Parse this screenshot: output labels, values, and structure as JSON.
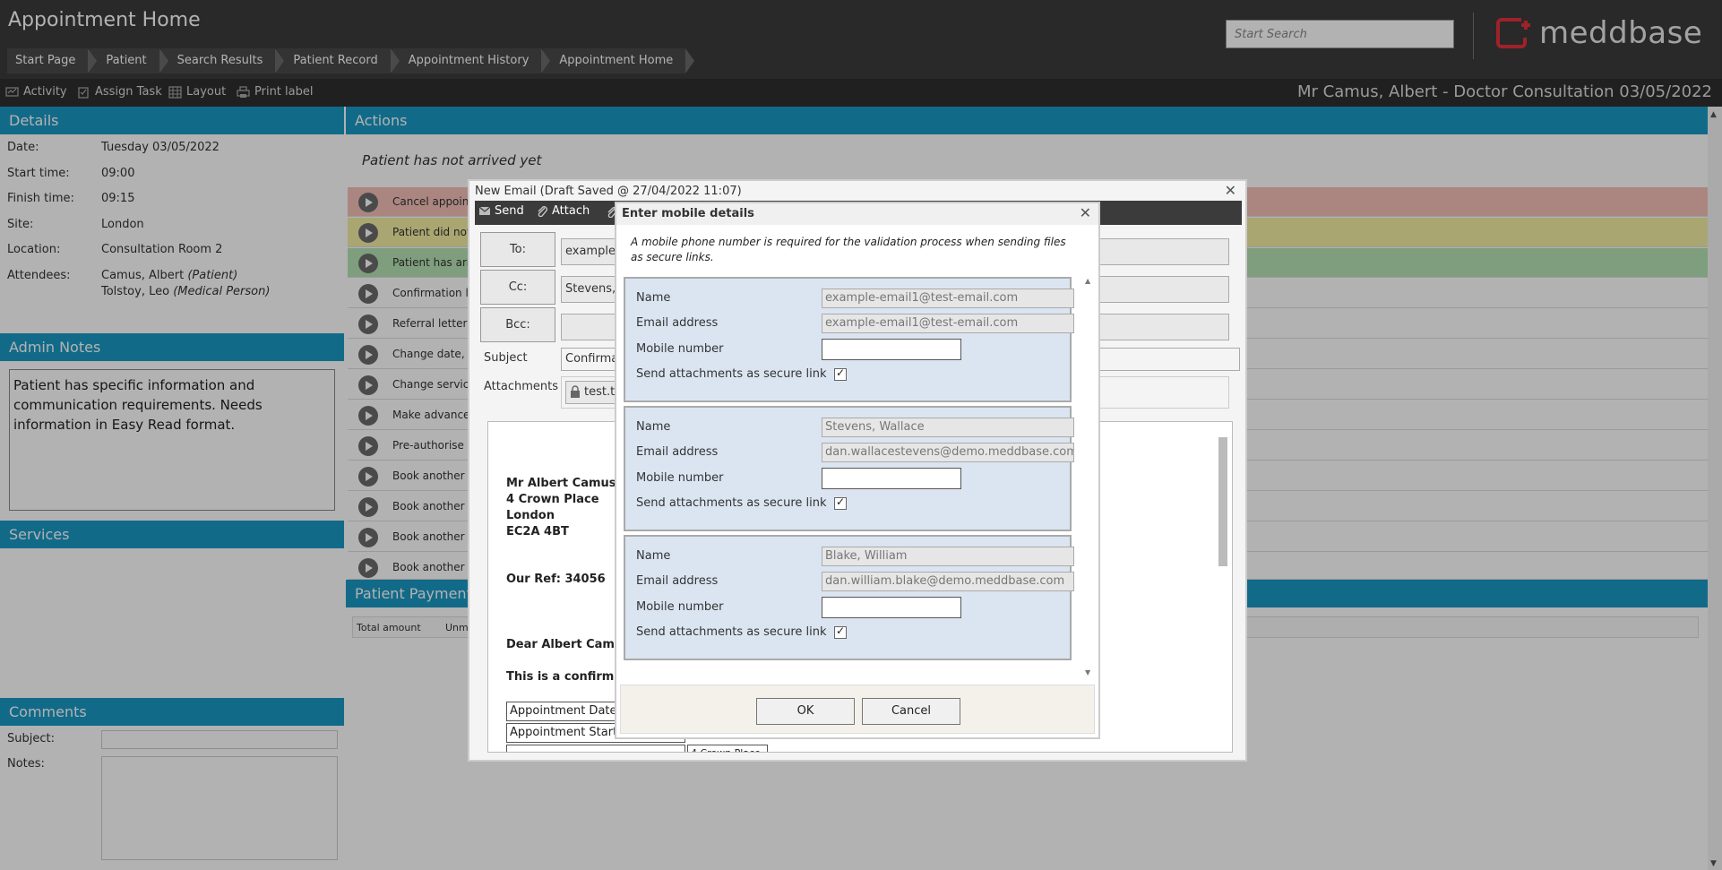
{
  "app": {
    "title": "Appointment Home",
    "search_placeholder": "Start Search",
    "logo_text": "meddbase",
    "brand_color": "#e2323b",
    "accent_color": "#1a98c5"
  },
  "breadcrumb": [
    "Start Page",
    "Patient",
    "Search Results",
    "Patient Record",
    "Appointment History",
    "Appointment Home"
  ],
  "toolbar": {
    "items": [
      {
        "label": "Activity",
        "icon": "activity-icon"
      },
      {
        "label": "Assign Task",
        "icon": "clipboard-icon"
      },
      {
        "label": "Layout",
        "icon": "grid-icon"
      },
      {
        "label": "Print label",
        "icon": "printer-icon"
      }
    ],
    "appointment_title": "Mr Camus, Albert - Doctor Consultation 03/05/2022"
  },
  "details": {
    "heading": "Details",
    "date_label": "Date:",
    "date": "Tuesday 03/05/2022",
    "start_label": "Start time:",
    "start": "09:00",
    "finish_label": "Finish time:",
    "finish": "09:15",
    "site_label": "Site:",
    "site": "London",
    "location_label": "Location:",
    "location": "Consultation Room 2",
    "attendees_label": "Attendees:",
    "attendee1_name": "Camus, Albert",
    "attendee1_role": "(Patient)",
    "attendee2_name": "Tolstoy, Leo",
    "attendee2_role": "(Medical Person)"
  },
  "admin_notes": {
    "heading": "Admin Notes",
    "text": "Patient has specific information and communication requirements. Needs information in Easy Read format."
  },
  "services": {
    "heading": "Services"
  },
  "comments": {
    "heading": "Comments",
    "subject_label": "Subject:",
    "notes_label": "Notes:"
  },
  "actions": {
    "heading": "Actions",
    "status": "Patient has not arrived yet",
    "rows": [
      "Cancel appoint",
      "Patient did not",
      "Patient has arri",
      "Confirmation le",
      "Referral letter a",
      "Change date, ti",
      "Change service",
      "Make advance p",
      "Pre-authorise p",
      "Book another a",
      "Book another a",
      "Book another a",
      "Book another a"
    ]
  },
  "payments": {
    "heading": "Patient Payments",
    "total_label": "Total amount",
    "col2": "Unm"
  },
  "email": {
    "title": "New Email (Draft Saved @ 27/04/2022 11:07)",
    "send": "Send",
    "attach": "Attach",
    "to_label": "To:",
    "to_value": "example-e",
    "cc_label": "Cc:",
    "cc_value": "Stevens, W",
    "bcc_label": "Bcc:",
    "subject_label": "Subject",
    "subject_value": "Confirmatio",
    "attachments_label": "Attachments",
    "attachment_file": "test.tx",
    "letter": {
      "name": "Mr Albert Camus",
      "addr1": "4 Crown Place",
      "addr2": "London",
      "addr3": "EC2A 4BT",
      "ref": "Our Ref: 34056",
      "salutation": "Dear Albert Camus",
      "body": "This is a confirmatio",
      "table_c1": "Appointment Date",
      "table_c2": "Appointment Start T",
      "table_c3": "4 Crown Place"
    }
  },
  "mobile_dialog": {
    "title": "Enter mobile details",
    "info": "A mobile phone number is required for the validation process when sending files as secure links.",
    "name_label": "Name",
    "email_label": "Email address",
    "mobile_label": "Mobile number",
    "secure_label": "Send attachments as secure link",
    "recipients": [
      {
        "name": "example-email1@test-email.com",
        "email": "example-email1@test-email.com",
        "mobile": ""
      },
      {
        "name": "Stevens, Wallace",
        "email": "dan.wallacestevens@demo.meddbase.com",
        "mobile": ""
      },
      {
        "name": "Blake, William",
        "email": "dan.william.blake@demo.meddbase.com",
        "mobile": ""
      }
    ],
    "ok": "OK",
    "cancel": "Cancel"
  }
}
